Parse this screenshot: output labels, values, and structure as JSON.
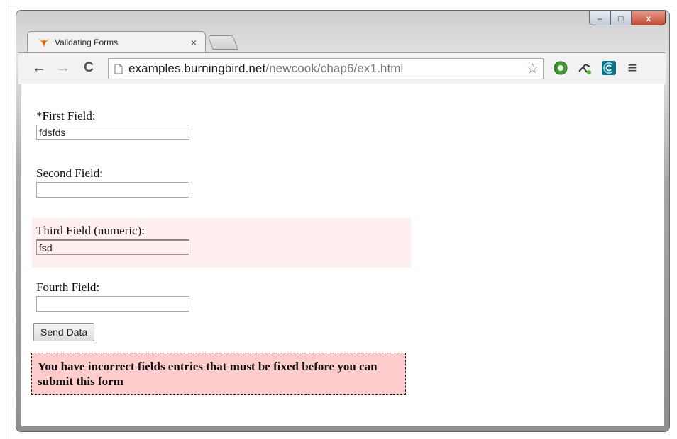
{
  "browser": {
    "tab_title": "Validating Forms",
    "tab_close": "×",
    "url_domain": "examples.burningbird.net",
    "url_path": "/newcook/chap6/ex1.html",
    "controls": {
      "minimize": "–",
      "maximize": "□",
      "close": "x"
    },
    "nav": {
      "back": "←",
      "forward": "→",
      "reload": "C"
    },
    "star": "☆",
    "menu": "≡"
  },
  "form": {
    "first": {
      "label": "*First Field:",
      "value": "fdsfds"
    },
    "second": {
      "label": "Second Field:",
      "value": ""
    },
    "third": {
      "label": "Third Field (numeric):",
      "value": "fsd",
      "invalid": true
    },
    "fourth": {
      "label": "Fourth Field:",
      "value": ""
    },
    "submit_label": "Send Data",
    "error_message": "You have incorrect fields entries that must be fixed before you can submit this form"
  },
  "colors": {
    "invalid_field_bg": "#ffeeee",
    "error_box_bg": "#ffcccc"
  }
}
